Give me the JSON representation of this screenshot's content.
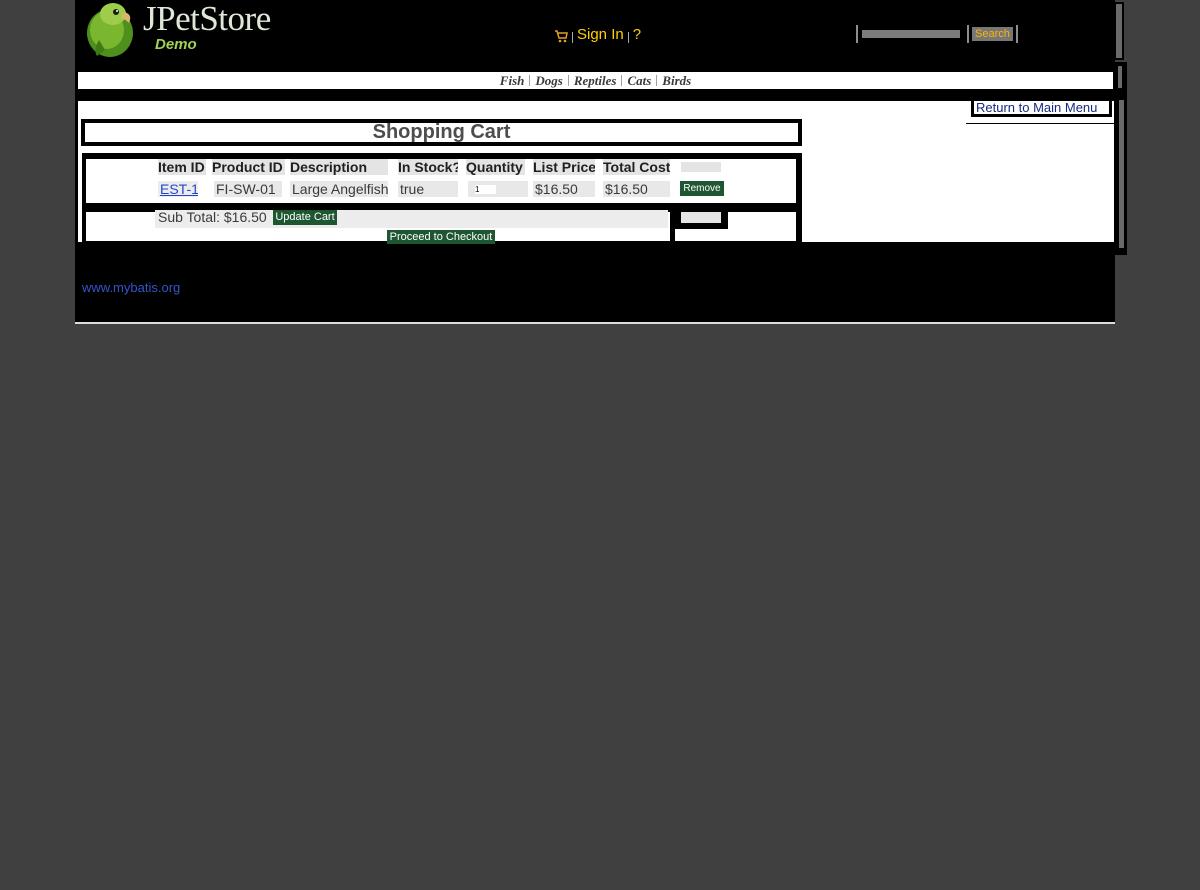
{
  "logo": {
    "name": "JPetStore",
    "tagline": "Demo"
  },
  "menu": {
    "sign_in": "Sign In",
    "help": "?"
  },
  "search": {
    "button": "Search",
    "value": ""
  },
  "categories": [
    "Fish",
    "Dogs",
    "Reptiles",
    "Cats",
    "Birds"
  ],
  "back_link": "Return to Main Menu",
  "cart": {
    "title": "Shopping Cart",
    "headers": {
      "item_id": "Item ID",
      "product_id": "Product ID",
      "description": "Description",
      "in_stock": "In Stock?",
      "quantity": "Quantity",
      "list_price": "List Price",
      "total_cost": "Total Cost"
    },
    "row": {
      "item_id": "EST-1",
      "product_id": "FI-SW-01",
      "description": "Large Angelfish",
      "in_stock": "true",
      "quantity": "1",
      "list_price": "$16.50",
      "total_cost": "$16.50",
      "remove": "Remove"
    },
    "subtotal": "Sub Total: $16.50",
    "update": "Update Cart",
    "checkout": "Proceed to Checkout"
  },
  "footer": {
    "link": "www.mybatis.org"
  },
  "colors": {
    "button_green": "#1d5631",
    "link_yellow": "#ffd000",
    "search_orange": "#ffb400"
  }
}
